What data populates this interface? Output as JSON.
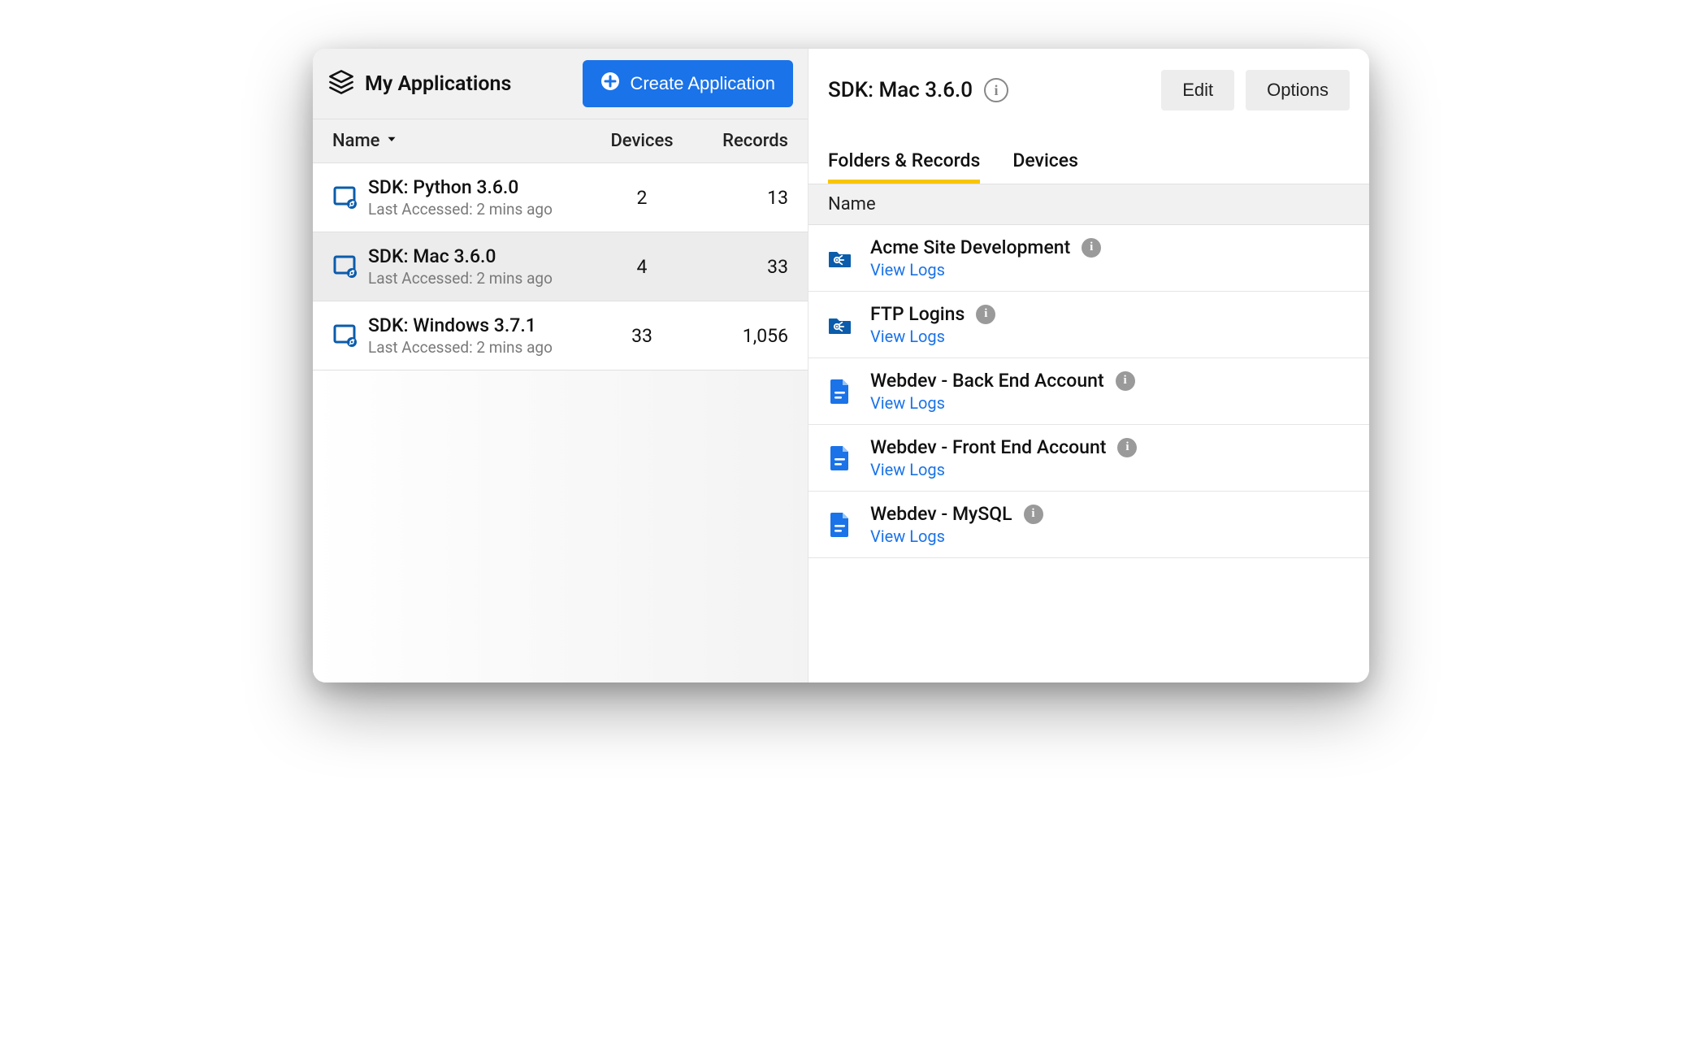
{
  "header": {
    "title": "My Applications",
    "create_label": "Create Application"
  },
  "columns": {
    "name": "Name",
    "devices": "Devices",
    "records": "Records"
  },
  "apps": [
    {
      "name": "SDK: Python 3.6.0",
      "sub": "Last Accessed: 2 mins ago",
      "devices": "2",
      "records": "13",
      "selected": false
    },
    {
      "name": "SDK: Mac 3.6.0",
      "sub": "Last Accessed: 2 mins ago",
      "devices": "4",
      "records": "33",
      "selected": true
    },
    {
      "name": "SDK: Windows 3.7.1",
      "sub": "Last Accessed: 2 mins ago",
      "devices": "33",
      "records": "1,056",
      "selected": false
    }
  ],
  "detail": {
    "title": "SDK: Mac 3.6.0",
    "edit": "Edit",
    "options": "Options",
    "tabs": {
      "folders": "Folders & Records",
      "devices": "Devices"
    },
    "list_header": "Name",
    "view_logs": "View Logs",
    "records": [
      {
        "name": "Acme Site Development",
        "type": "folder"
      },
      {
        "name": "FTP Logins",
        "type": "folder"
      },
      {
        "name": "Webdev - Back End Account",
        "type": "file"
      },
      {
        "name": "Webdev - Front End Account",
        "type": "file"
      },
      {
        "name": "Webdev - MySQL",
        "type": "file"
      }
    ]
  }
}
